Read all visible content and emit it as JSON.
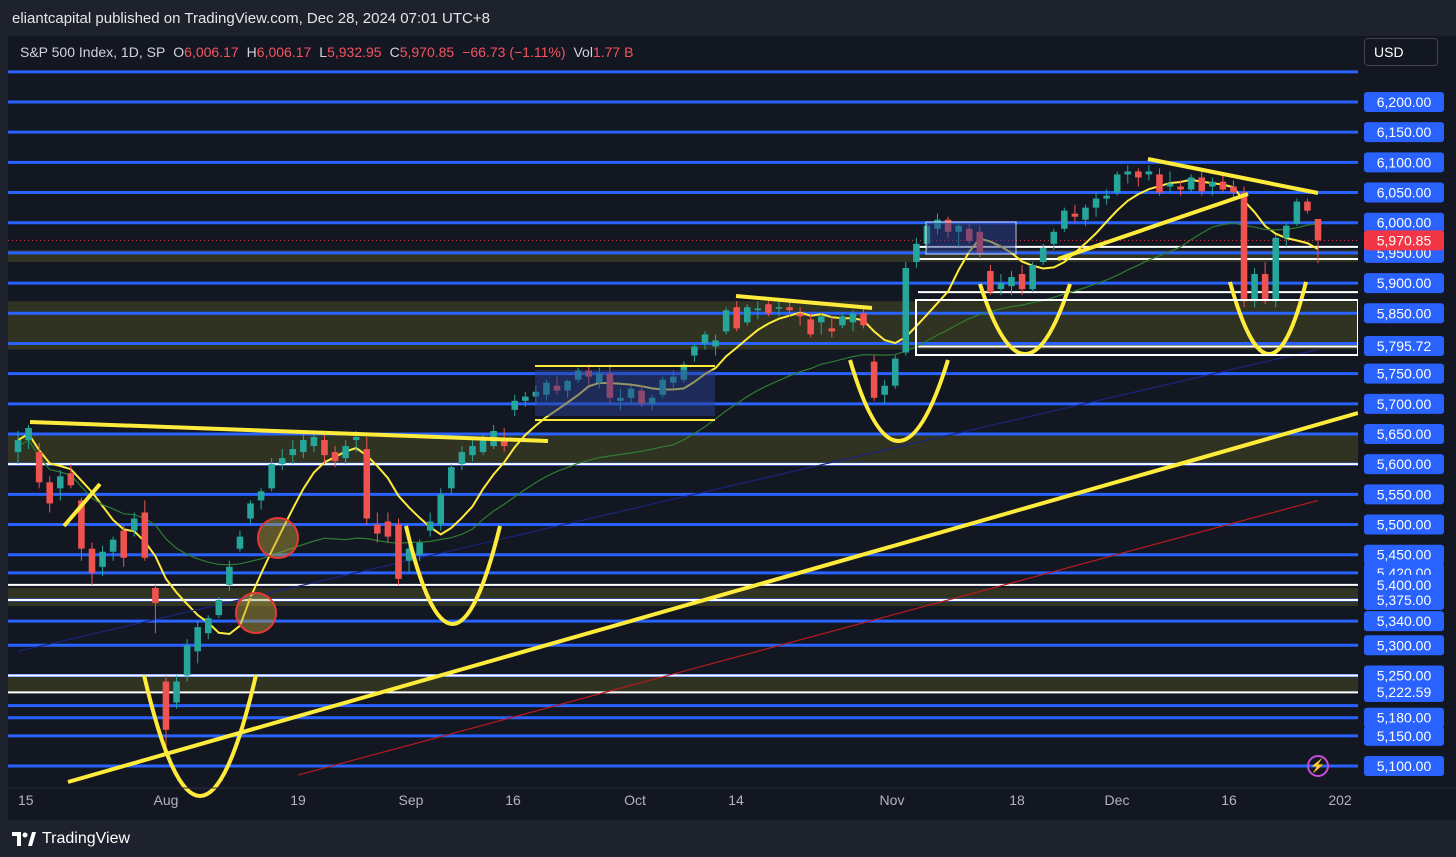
{
  "header": {
    "publisher_line": "eliantcapital published on TradingView.com, Dec 28, 2024 07:01 UTC+8"
  },
  "legend": {
    "symbol": "S&P 500 Index, 1D, SP",
    "open_label": "O",
    "open": "6,006.17",
    "high_label": "H",
    "high": "6,006.17",
    "low_label": "L",
    "low": "5,932.95",
    "close_label": "C",
    "close": "5,970.85",
    "change": "−66.73 (−1.11%)",
    "vol_label": "Vol",
    "vol": "1.77 B"
  },
  "currency_button": "USD",
  "footer": {
    "brand": "TradingView"
  },
  "colors": {
    "background": "#131722",
    "up_candle": "#26a69a",
    "down_candle": "#ef5350",
    "level_line": "#2962ff",
    "trendline": "#ffeb3b",
    "ma_short": "#ffeb3b",
    "ma_mid": "#2e7d32",
    "ma_long_blue": "#1a237e",
    "ma_long_red": "#b71c1c",
    "current_price_tag": "#f23645"
  },
  "chart_data": {
    "type": "candlestick",
    "title": "S&P 500 Index, 1D, SP",
    "y_range": [
      5080,
      6255
    ],
    "price_ticks": [
      "6,200.00",
      "6,150.00",
      "6,100.00",
      "6,050.00",
      "6,000.00",
      "5,950.00",
      "5,900.00",
      "5,850.00",
      "5,750.00",
      "5,700.00",
      "5,650.00",
      "5,600.00",
      "5,550.00",
      "5,500.00",
      "5,450.00",
      "5,420.00",
      "5,400.00",
      "5,375.00",
      "5,340.00",
      "5,300.00",
      "5,250.00",
      "5,180.00",
      "5,150.00",
      "5,100.00"
    ],
    "price_tick_values": [
      6200,
      6150,
      6100,
      6050,
      6000,
      5950,
      5900,
      5850,
      5750,
      5700,
      5650,
      5600,
      5550,
      5500,
      5450,
      5420,
      5400,
      5375,
      5340,
      5300,
      5250,
      5180,
      5150,
      5100
    ],
    "highlighted_levels": [
      {
        "label": "5,970.85",
        "value": 5970.85,
        "kind": "current"
      },
      {
        "label": "5,795.72",
        "value": 5795.72,
        "kind": "marked"
      },
      {
        "label": "5,222.59",
        "value": 5222.59,
        "kind": "marked"
      }
    ],
    "blue_levels": [
      6250,
      6200,
      6150,
      6100,
      6050,
      6000,
      5950,
      5900,
      5850,
      5800,
      5750,
      5700,
      5650,
      5600,
      5550,
      5500,
      5450,
      5420,
      5375,
      5340,
      5300,
      5250,
      5200,
      5180,
      5150,
      5100
    ],
    "time_labels": [
      "15",
      "Aug",
      "19",
      "Sep",
      "16",
      "Oct",
      "14",
      "Nov",
      "18",
      "Dec",
      "16",
      "202"
    ],
    "candles": [
      {
        "o": 5620,
        "h": 5655,
        "l": 5600,
        "c": 5640
      },
      {
        "o": 5640,
        "h": 5665,
        "l": 5625,
        "c": 5660
      },
      {
        "o": 5620,
        "h": 5635,
        "l": 5560,
        "c": 5570
      },
      {
        "o": 5570,
        "h": 5580,
        "l": 5520,
        "c": 5535
      },
      {
        "o": 5560,
        "h": 5590,
        "l": 5540,
        "c": 5580
      },
      {
        "o": 5585,
        "h": 5600,
        "l": 5560,
        "c": 5565
      },
      {
        "o": 5540,
        "h": 5545,
        "l": 5440,
        "c": 5460
      },
      {
        "o": 5460,
        "h": 5470,
        "l": 5400,
        "c": 5420
      },
      {
        "o": 5430,
        "h": 5465,
        "l": 5415,
        "c": 5455
      },
      {
        "o": 5455,
        "h": 5480,
        "l": 5440,
        "c": 5475
      },
      {
        "o": 5490,
        "h": 5500,
        "l": 5430,
        "c": 5445
      },
      {
        "o": 5490,
        "h": 5520,
        "l": 5480,
        "c": 5510
      },
      {
        "o": 5520,
        "h": 5540,
        "l": 5440,
        "c": 5445
      },
      {
        "o": 5395,
        "h": 5400,
        "l": 5320,
        "c": 5370
      },
      {
        "o": 5240,
        "h": 5250,
        "l": 5130,
        "c": 5160
      },
      {
        "o": 5205,
        "h": 5250,
        "l": 5195,
        "c": 5240
      },
      {
        "o": 5250,
        "h": 5310,
        "l": 5240,
        "c": 5300
      },
      {
        "o": 5290,
        "h": 5340,
        "l": 5270,
        "c": 5330
      },
      {
        "o": 5320,
        "h": 5350,
        "l": 5310,
        "c": 5345
      },
      {
        "o": 5350,
        "h": 5380,
        "l": 5345,
        "c": 5375
      },
      {
        "o": 5400,
        "h": 5440,
        "l": 5390,
        "c": 5430
      },
      {
        "o": 5460,
        "h": 5490,
        "l": 5455,
        "c": 5480
      },
      {
        "o": 5510,
        "h": 5540,
        "l": 5500,
        "c": 5535
      },
      {
        "o": 5540,
        "h": 5560,
        "l": 5525,
        "c": 5555
      },
      {
        "o": 5560,
        "h": 5610,
        "l": 5555,
        "c": 5600
      },
      {
        "o": 5600,
        "h": 5625,
        "l": 5590,
        "c": 5610
      },
      {
        "o": 5615,
        "h": 5640,
        "l": 5600,
        "c": 5625
      },
      {
        "o": 5620,
        "h": 5650,
        "l": 5610,
        "c": 5640
      },
      {
        "o": 5630,
        "h": 5655,
        "l": 5620,
        "c": 5645
      },
      {
        "o": 5640,
        "h": 5655,
        "l": 5600,
        "c": 5615
      },
      {
        "o": 5620,
        "h": 5630,
        "l": 5595,
        "c": 5605
      },
      {
        "o": 5610,
        "h": 5640,
        "l": 5600,
        "c": 5630
      },
      {
        "o": 5640,
        "h": 5655,
        "l": 5620,
        "c": 5645
      },
      {
        "o": 5625,
        "h": 5645,
        "l": 5500,
        "c": 5510
      },
      {
        "o": 5500,
        "h": 5520,
        "l": 5470,
        "c": 5485
      },
      {
        "o": 5505,
        "h": 5520,
        "l": 5470,
        "c": 5480
      },
      {
        "o": 5500,
        "h": 5510,
        "l": 5400,
        "c": 5410
      },
      {
        "o": 5440,
        "h": 5470,
        "l": 5420,
        "c": 5460
      },
      {
        "o": 5450,
        "h": 5475,
        "l": 5440,
        "c": 5470
      },
      {
        "o": 5490,
        "h": 5520,
        "l": 5480,
        "c": 5505
      },
      {
        "o": 5500,
        "h": 5560,
        "l": 5490,
        "c": 5550
      },
      {
        "o": 5560,
        "h": 5600,
        "l": 5550,
        "c": 5595
      },
      {
        "o": 5600,
        "h": 5630,
        "l": 5590,
        "c": 5620
      },
      {
        "o": 5615,
        "h": 5640,
        "l": 5605,
        "c": 5630
      },
      {
        "o": 5620,
        "h": 5650,
        "l": 5615,
        "c": 5640
      },
      {
        "o": 5630,
        "h": 5665,
        "l": 5625,
        "c": 5655
      },
      {
        "o": 5640,
        "h": 5660,
        "l": 5620,
        "c": 5630
      },
      {
        "o": 5690,
        "h": 5715,
        "l": 5680,
        "c": 5705
      },
      {
        "o": 5705,
        "h": 5720,
        "l": 5695,
        "c": 5712
      },
      {
        "o": 5712,
        "h": 5730,
        "l": 5700,
        "c": 5720
      },
      {
        "o": 5715,
        "h": 5740,
        "l": 5705,
        "c": 5735
      },
      {
        "o": 5730,
        "h": 5745,
        "l": 5715,
        "c": 5722
      },
      {
        "o": 5722,
        "h": 5740,
        "l": 5710,
        "c": 5738
      },
      {
        "o": 5740,
        "h": 5760,
        "l": 5735,
        "c": 5755
      },
      {
        "o": 5755,
        "h": 5765,
        "l": 5730,
        "c": 5745
      },
      {
        "o": 5735,
        "h": 5760,
        "l": 5725,
        "c": 5750
      },
      {
        "o": 5750,
        "h": 5765,
        "l": 5700,
        "c": 5710
      },
      {
        "o": 5705,
        "h": 5725,
        "l": 5690,
        "c": 5710
      },
      {
        "o": 5710,
        "h": 5730,
        "l": 5700,
        "c": 5725
      },
      {
        "o": 5722,
        "h": 5730,
        "l": 5695,
        "c": 5700
      },
      {
        "o": 5700,
        "h": 5715,
        "l": 5690,
        "c": 5710
      },
      {
        "o": 5715,
        "h": 5745,
        "l": 5710,
        "c": 5740
      },
      {
        "o": 5735,
        "h": 5755,
        "l": 5725,
        "c": 5745
      },
      {
        "o": 5740,
        "h": 5770,
        "l": 5735,
        "c": 5765
      },
      {
        "o": 5780,
        "h": 5800,
        "l": 5770,
        "c": 5795
      },
      {
        "o": 5800,
        "h": 5820,
        "l": 5790,
        "c": 5815
      },
      {
        "o": 5795,
        "h": 5815,
        "l": 5780,
        "c": 5805
      },
      {
        "o": 5820,
        "h": 5860,
        "l": 5815,
        "c": 5855
      },
      {
        "o": 5860,
        "h": 5870,
        "l": 5820,
        "c": 5825
      },
      {
        "o": 5835,
        "h": 5865,
        "l": 5830,
        "c": 5860
      },
      {
        "o": 5855,
        "h": 5870,
        "l": 5840,
        "c": 5858
      },
      {
        "o": 5865,
        "h": 5875,
        "l": 5845,
        "c": 5850
      },
      {
        "o": 5858,
        "h": 5870,
        "l": 5845,
        "c": 5860
      },
      {
        "o": 5860,
        "h": 5870,
        "l": 5845,
        "c": 5855
      },
      {
        "o": 5850,
        "h": 5860,
        "l": 5830,
        "c": 5845
      },
      {
        "o": 5840,
        "h": 5850,
        "l": 5810,
        "c": 5815
      },
      {
        "o": 5835,
        "h": 5850,
        "l": 5815,
        "c": 5845
      },
      {
        "o": 5825,
        "h": 5845,
        "l": 5810,
        "c": 5820
      },
      {
        "o": 5830,
        "h": 5850,
        "l": 5825,
        "c": 5845
      },
      {
        "o": 5835,
        "h": 5855,
        "l": 5820,
        "c": 5850
      },
      {
        "o": 5850,
        "h": 5860,
        "l": 5825,
        "c": 5830
      },
      {
        "o": 5770,
        "h": 5780,
        "l": 5705,
        "c": 5710
      },
      {
        "o": 5715,
        "h": 5740,
        "l": 5700,
        "c": 5730
      },
      {
        "o": 5730,
        "h": 5780,
        "l": 5725,
        "c": 5775
      },
      {
        "o": 5785,
        "h": 5935,
        "l": 5780,
        "c": 5925
      },
      {
        "o": 5935,
        "h": 5975,
        "l": 5925,
        "c": 5965
      },
      {
        "o": 5965,
        "h": 6000,
        "l": 5955,
        "c": 5995
      },
      {
        "o": 5990,
        "h": 6015,
        "l": 5980,
        "c": 6005
      },
      {
        "o": 6005,
        "h": 6010,
        "l": 5975,
        "c": 5985
      },
      {
        "o": 5985,
        "h": 6000,
        "l": 5960,
        "c": 5995
      },
      {
        "o": 5990,
        "h": 6000,
        "l": 5965,
        "c": 5970
      },
      {
        "o": 5985,
        "h": 5995,
        "l": 5940,
        "c": 5950
      },
      {
        "o": 5920,
        "h": 5930,
        "l": 5880,
        "c": 5885
      },
      {
        "o": 5890,
        "h": 5915,
        "l": 5880,
        "c": 5900
      },
      {
        "o": 5895,
        "h": 5920,
        "l": 5880,
        "c": 5910
      },
      {
        "o": 5915,
        "h": 5930,
        "l": 5880,
        "c": 5890
      },
      {
        "o": 5890,
        "h": 5935,
        "l": 5885,
        "c": 5930
      },
      {
        "o": 5935,
        "h": 5965,
        "l": 5930,
        "c": 5958
      },
      {
        "o": 5965,
        "h": 5990,
        "l": 5955,
        "c": 5985
      },
      {
        "o": 5990,
        "h": 6025,
        "l": 5985,
        "c": 6020
      },
      {
        "o": 6015,
        "h": 6030,
        "l": 6000,
        "c": 6010
      },
      {
        "o": 6005,
        "h": 6030,
        "l": 5995,
        "c": 6025
      },
      {
        "o": 6025,
        "h": 6050,
        "l": 6010,
        "c": 6040
      },
      {
        "o": 6040,
        "h": 6055,
        "l": 6030,
        "c": 6045
      },
      {
        "o": 6050,
        "h": 6085,
        "l": 6045,
        "c": 6080
      },
      {
        "o": 6080,
        "h": 6095,
        "l": 6065,
        "c": 6085
      },
      {
        "o": 6085,
        "h": 6090,
        "l": 6060,
        "c": 6075
      },
      {
        "o": 6080,
        "h": 6095,
        "l": 6070,
        "c": 6085
      },
      {
        "o": 6080,
        "h": 6090,
        "l": 6045,
        "c": 6050
      },
      {
        "o": 6060,
        "h": 6085,
        "l": 6050,
        "c": 6065
      },
      {
        "o": 6060,
        "h": 6070,
        "l": 6045,
        "c": 6055
      },
      {
        "o": 6055,
        "h": 6080,
        "l": 6050,
        "c": 6075
      },
      {
        "o": 6075,
        "h": 6085,
        "l": 6045,
        "c": 6052
      },
      {
        "o": 6060,
        "h": 6075,
        "l": 6045,
        "c": 6068
      },
      {
        "o": 6068,
        "h": 6080,
        "l": 6050,
        "c": 6055
      },
      {
        "o": 6060,
        "h": 6070,
        "l": 6040,
        "c": 6050
      },
      {
        "o": 6050,
        "h": 6060,
        "l": 5860,
        "c": 5870
      },
      {
        "o": 5870,
        "h": 5925,
        "l": 5860,
        "c": 5915
      },
      {
        "o": 5915,
        "h": 5935,
        "l": 5865,
        "c": 5870
      },
      {
        "o": 5870,
        "h": 5980,
        "l": 5860,
        "c": 5975
      },
      {
        "o": 5975,
        "h": 6000,
        "l": 5960,
        "c": 5995
      },
      {
        "o": 5998,
        "h": 6040,
        "l": 5995,
        "c": 6035
      },
      {
        "o": 6035,
        "h": 6040,
        "l": 6015,
        "c": 6020
      },
      {
        "o": 6006.17,
        "h": 6006.17,
        "l": 5932.95,
        "c": 5970.85
      }
    ]
  }
}
